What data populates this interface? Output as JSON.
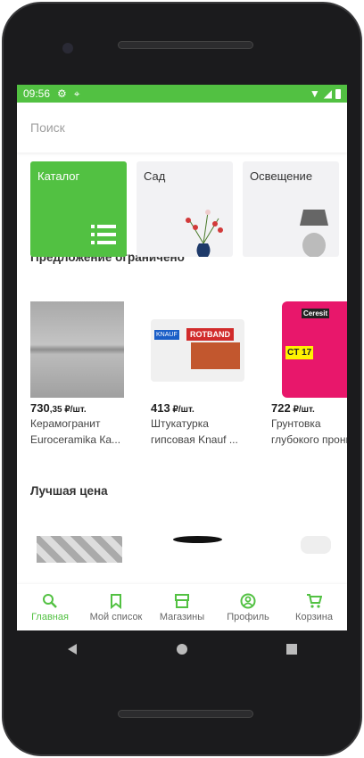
{
  "status": {
    "time": "09:56"
  },
  "search": {
    "placeholder": "Поиск"
  },
  "categories": [
    {
      "label": "Каталог"
    },
    {
      "label": "Сад"
    },
    {
      "label": "Освещение"
    }
  ],
  "section1": {
    "title": "Предложение ограничено"
  },
  "products": [
    {
      "price_main": "730",
      "price_cents": ",35",
      "unit": " ₽/шт.",
      "name1": "Керамогранит",
      "name2": "Euroceramika Ка..."
    },
    {
      "price_main": "413",
      "price_cents": "",
      "unit": " ₽/шт.",
      "name1": "Штукатурка",
      "name2": "гипсовая Knauf ..."
    },
    {
      "price_main": "722",
      "price_cents": "",
      "unit": " ₽/шт.",
      "name1": "Грунтовка",
      "name2": "глубокого проникновения"
    }
  ],
  "product_labels": {
    "knauf": "KNAUF",
    "rotband": "ROTBAND",
    "ceresit": "Ceresit",
    "ct17": "CT 17"
  },
  "section2": {
    "title": "Лучшая цена"
  },
  "tabs": [
    {
      "label": "Главная",
      "icon": "search-icon"
    },
    {
      "label": "Мой список",
      "icon": "bookmark-icon"
    },
    {
      "label": "Магазины",
      "icon": "store-icon"
    },
    {
      "label": "Профиль",
      "icon": "profile-icon"
    },
    {
      "label": "Корзина",
      "icon": "cart-icon"
    }
  ],
  "colors": {
    "accent": "#52c142"
  }
}
